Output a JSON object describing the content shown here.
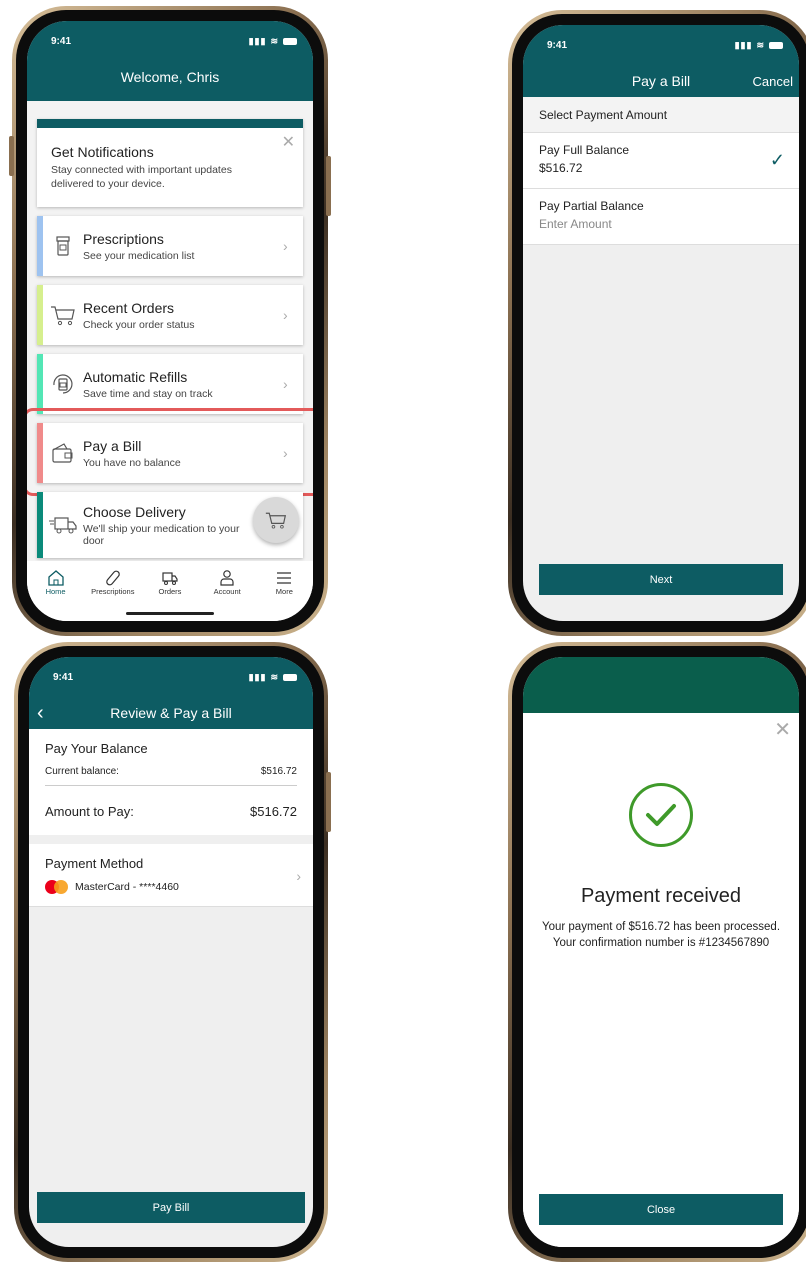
{
  "status_time": "9:41",
  "screen_home": {
    "title": "Welcome, Chris",
    "notification": {
      "title": "Get Notifications",
      "desc": "Stay connected with important updates delivered to your device."
    },
    "cards": [
      {
        "title": "Prescriptions",
        "desc": "See your medication list",
        "color": "#9ec3f0",
        "icon": "prescription-bottle-icon"
      },
      {
        "title": "Recent Orders",
        "desc": "Check your order status",
        "color": "#d6ef8e",
        "icon": "cart-icon"
      },
      {
        "title": "Automatic Refills",
        "desc": "Save time and stay on track",
        "color": "#53e6b5",
        "icon": "auto-refill-icon"
      },
      {
        "title": "Pay a Bill",
        "desc": "You have no balance",
        "color": "#f08a8a",
        "icon": "wallet-icon"
      },
      {
        "title": "Choose Delivery",
        "desc": "We'll ship your medication to your door",
        "color": "#0a8a7a",
        "icon": "delivery-truck-icon"
      }
    ],
    "tabs": [
      {
        "label": "Home",
        "icon": "home-icon"
      },
      {
        "label": "Prescriptions",
        "icon": "pill-icon"
      },
      {
        "label": "Orders",
        "icon": "truck-icon"
      },
      {
        "label": "Account",
        "icon": "user-icon"
      },
      {
        "label": "More",
        "icon": "menu-icon"
      }
    ]
  },
  "screen_pay": {
    "title": "Pay a Bill",
    "cancel": "Cancel",
    "section": "Select Payment Amount",
    "full_label": "Pay Full Balance",
    "full_value": "$516.72",
    "partial_label": "Pay Partial Balance",
    "partial_placeholder": "Enter Amount",
    "next": "Next"
  },
  "screen_review": {
    "title": "Review & Pay a Bill",
    "balance_heading": "Pay Your Balance",
    "current_label": "Current balance:",
    "current_value": "$516.72",
    "amount_label": "Amount to Pay:",
    "amount_value": "$516.72",
    "method_heading": "Payment Method",
    "method_value": "MasterCard - ****4460",
    "pay_button": "Pay Bill"
  },
  "screen_done": {
    "title": "Payment received",
    "message": "Your payment of $516.72 has been processed. Your confirmation number is #1234567890",
    "close": "Close"
  },
  "colors": {
    "brand_teal": "#0d5c63",
    "success_green": "#3f9a2a",
    "highlight_red": "#e35a5a"
  }
}
